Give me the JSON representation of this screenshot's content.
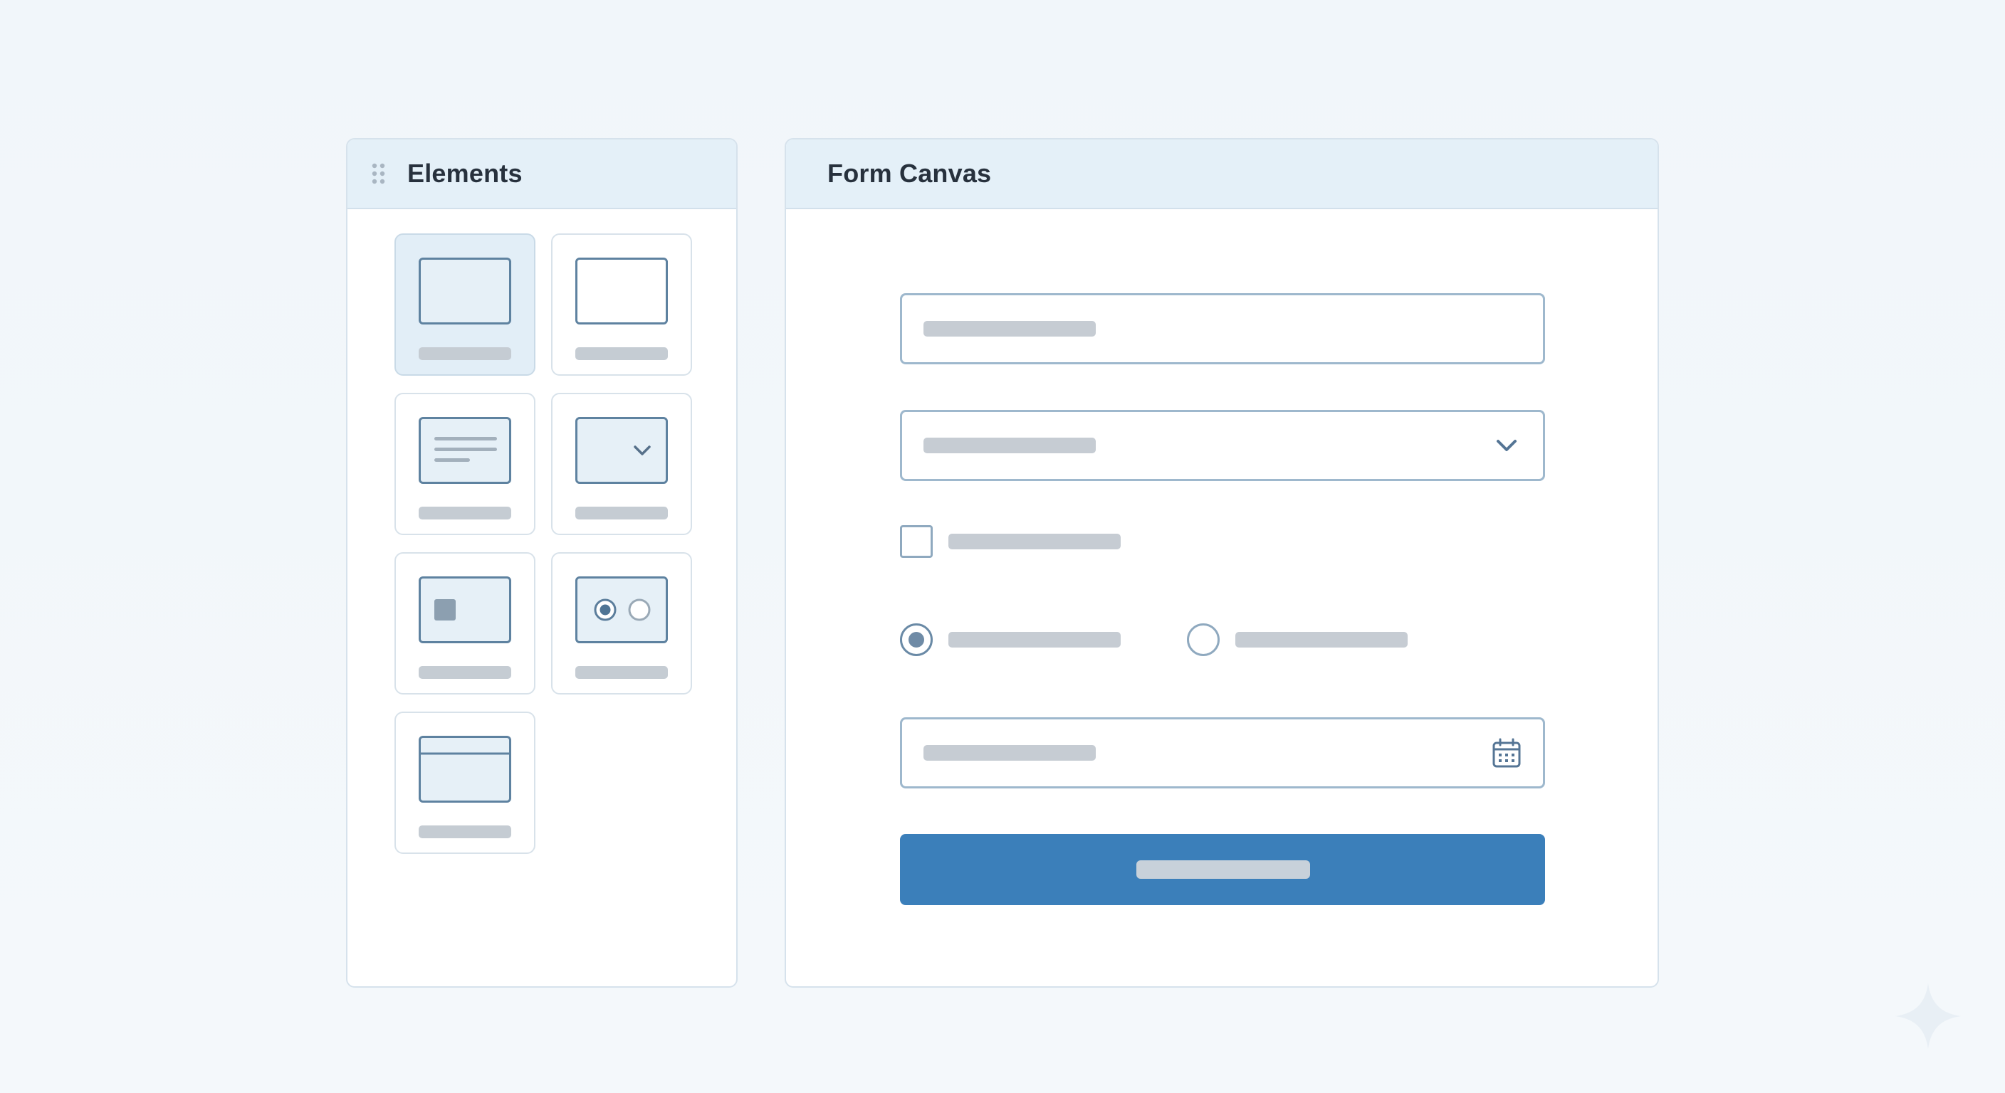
{
  "elements_panel": {
    "title": "Elements",
    "handle_icon": "drag-handle-icon",
    "tiles": [
      {
        "id": "text-input",
        "icon": "text-input-icon",
        "selected": true
      },
      {
        "id": "text-box",
        "icon": "blank-field-icon",
        "selected": false
      },
      {
        "id": "textarea",
        "icon": "textarea-icon",
        "selected": false
      },
      {
        "id": "dropdown",
        "icon": "dropdown-icon",
        "selected": false
      },
      {
        "id": "checkbox",
        "icon": "checkbox-icon",
        "selected": false
      },
      {
        "id": "radio-group",
        "icon": "radio-group-icon",
        "selected": false
      },
      {
        "id": "date-picker",
        "icon": "date-picker-icon",
        "selected": false
      }
    ]
  },
  "canvas_panel": {
    "title": "Form Canvas",
    "fields": {
      "text_input": {
        "type": "text"
      },
      "dropdown": {
        "type": "select",
        "icon": "chevron-down-icon"
      },
      "checkbox": {
        "type": "checkbox",
        "checked": false
      },
      "radio_group": {
        "type": "radio",
        "options": [
          {
            "checked": true
          },
          {
            "checked": false
          }
        ]
      },
      "date_input": {
        "type": "date",
        "icon": "calendar-icon"
      }
    },
    "submit": {
      "color": "#3b7fba"
    }
  },
  "colors": {
    "accent": "#3b7fba",
    "header_bg": "#e4f0f8",
    "placeholder": "#c6ccd3",
    "border": "#9eb8cd"
  }
}
